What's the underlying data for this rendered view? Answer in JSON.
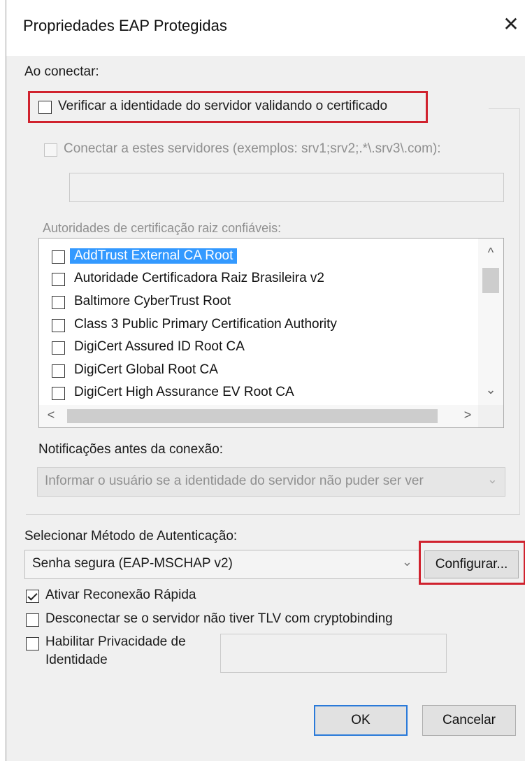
{
  "window": {
    "title": "Propriedades EAP Protegidas",
    "close_glyph": "✕"
  },
  "connect_section": {
    "label": "Ao conectar:",
    "verify_server": {
      "label": "Verificar a identidade do servidor validando o certificado",
      "checked": false
    },
    "connect_servers": {
      "label": "Conectar a estes servidores (exemplos: srv1;srv2;.*\\.srv3\\.com):",
      "checked": false,
      "value": ""
    },
    "root_ca_label": "Autoridades de certificação raiz confiáveis:",
    "root_cas": [
      {
        "name": "AddTrust External CA Root",
        "checked": false,
        "selected": true
      },
      {
        "name": "Autoridade Certificadora Raiz Brasileira v2",
        "checked": false,
        "selected": false
      },
      {
        "name": "Baltimore CyberTrust Root",
        "checked": false,
        "selected": false
      },
      {
        "name": "Class 3 Public Primary Certification Authority",
        "checked": false,
        "selected": false
      },
      {
        "name": "DigiCert Assured ID Root CA",
        "checked": false,
        "selected": false
      },
      {
        "name": "DigiCert Global Root CA",
        "checked": false,
        "selected": false
      },
      {
        "name": "DigiCert High Assurance EV Root CA",
        "checked": false,
        "selected": false
      }
    ],
    "notifications_label": "Notificações antes da conexão:",
    "notifications_value": "Informar o usuário se a identidade do servidor não puder ser ver"
  },
  "auth": {
    "label": "Selecionar Método de Autenticação:",
    "method_value": "Senha segura (EAP-MSCHAP v2)",
    "configure_label": "Configurar..."
  },
  "options": {
    "fast_reconnect": {
      "label": "Ativar Reconexão Rápida",
      "checked": true
    },
    "disconnect_tlv": {
      "label": "Desconectar se o servidor não tiver TLV com cryptobinding",
      "checked": false
    },
    "identity_privacy": {
      "label_line1": "Habilitar Privacidade de",
      "label_line2": "Identidade",
      "checked": false,
      "value": ""
    }
  },
  "footer": {
    "ok_label": "OK",
    "cancel_label": "Cancelar"
  },
  "glyphs": {
    "scroll_up": "^",
    "scroll_down": "⌄",
    "scroll_left": "<",
    "scroll_right": ">",
    "dropdown": "⌄"
  },
  "colors": {
    "highlight_box": "#d0222e",
    "selection": "#3399ff",
    "default_button_border": "#2a7ad9"
  }
}
